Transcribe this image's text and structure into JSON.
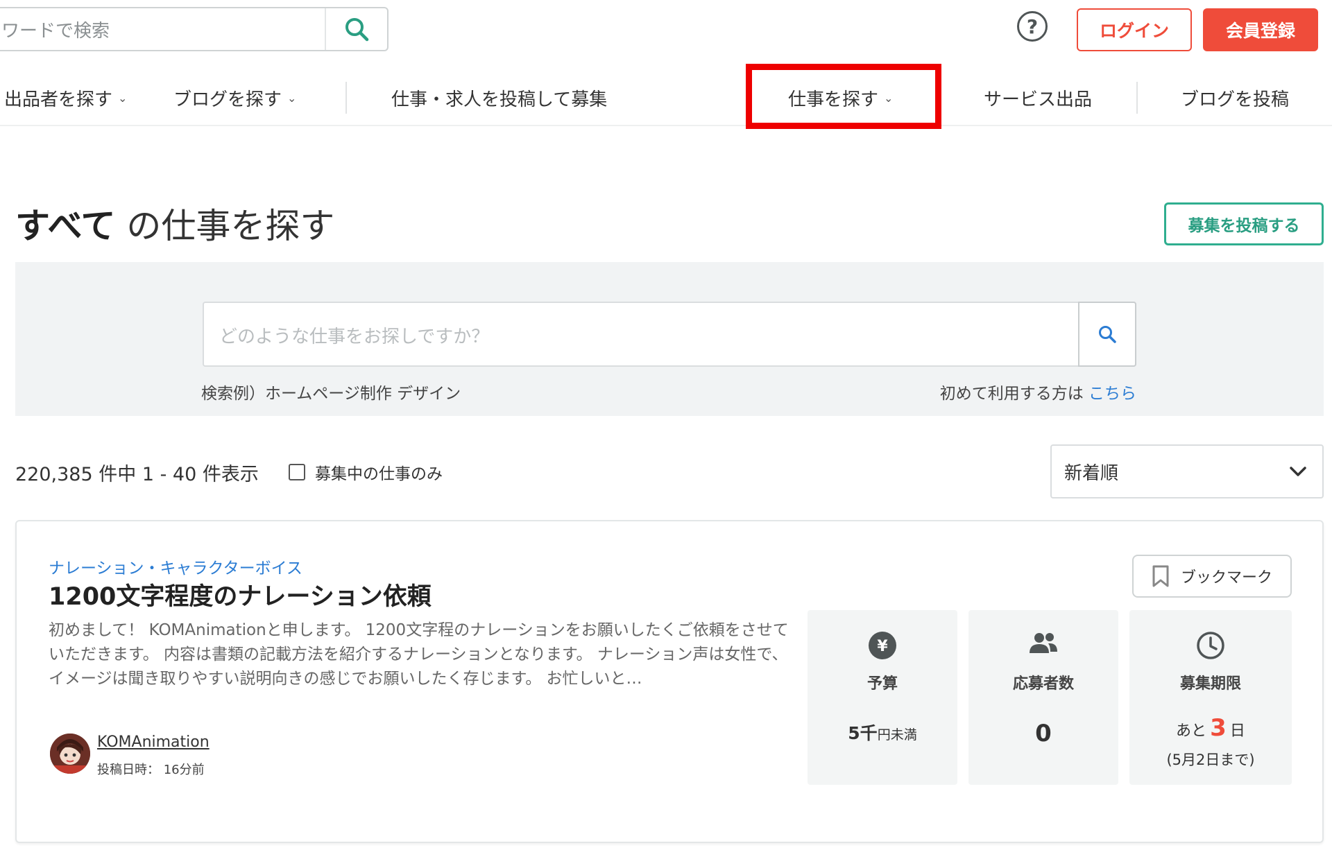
{
  "header": {
    "search_text": "ワードで検索",
    "help_symbol": "?",
    "login_label": "ログイン",
    "signup_label": "会員登録"
  },
  "nav": {
    "items": [
      {
        "label": "出品者を探す"
      },
      {
        "label": "ブログを探す"
      },
      {
        "label": "仕事・求人を投稿して募集"
      },
      {
        "label": "仕事を探す"
      },
      {
        "label": "サービス出品"
      },
      {
        "label": "ブログを投稿"
      }
    ],
    "chevron": "⌄"
  },
  "title": {
    "emphasis": "すべて",
    "rest": "の仕事を探す",
    "post_button": "募集を投稿する"
  },
  "search": {
    "placeholder": "どのような仕事をお探しですか？",
    "example": "検索例）ホームページ制作 デザイン",
    "first_time_text": "初めて利用する方は",
    "first_time_link": "こちら"
  },
  "results": {
    "count_text": "220,385 件中 1 - 40 件表示",
    "open_only_label": "募集中の仕事のみ",
    "sort_selected": "新着順"
  },
  "job": {
    "category": "ナレーション・キャラクターボイス",
    "title": "1200文字程度のナレーション依頼",
    "description": "初めまして！ KOMAnimationと申します。 1200文字程のナレーションをお願いしたくご依頼をさせていただきます。 内容は書類の記載方法を紹介するナレーションとなります。 ナレーション声は女性で、 イメージは聞き取りやすい説明向きの感じでお願いしたく存じます。 お忙しいと…",
    "username": "KOMAnimation",
    "posted_label": "投稿日時：",
    "posted_value": "16分前",
    "bookmark_label": "ブックマーク",
    "budget": {
      "label": "予算",
      "value_main": "5千",
      "value_unit": "円未満"
    },
    "applicants": {
      "label": "応募者数",
      "value": "0"
    },
    "deadline": {
      "label": "募集期限",
      "prefix": "あと",
      "days": "3",
      "suffix": "日",
      "date": "(5月2日まで)"
    }
  },
  "colors": {
    "brand_red": "#ef4c3a",
    "brand_green": "#2fae8f",
    "link_blue": "#2b7cd3",
    "highlight": "#ee0000"
  }
}
